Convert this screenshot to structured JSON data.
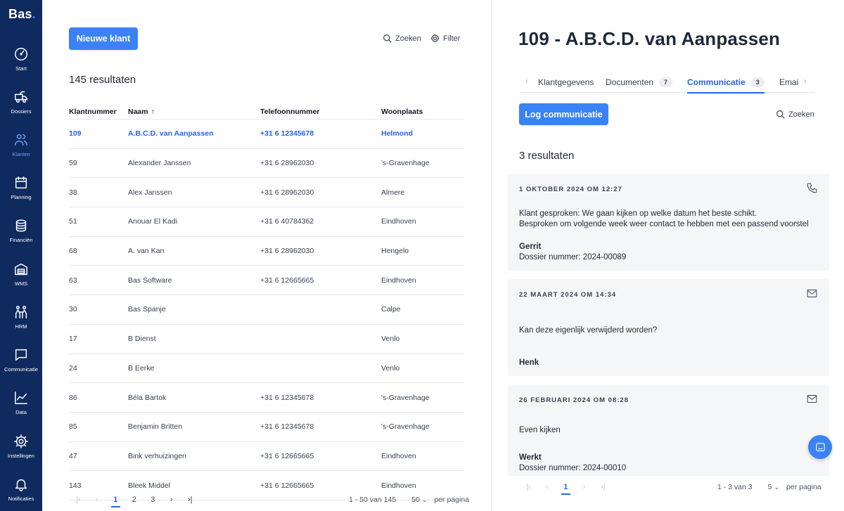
{
  "app": {
    "logo": "Bas",
    "logo_dot": "."
  },
  "sidebar": {
    "items": [
      {
        "label": "Start",
        "icon": "dashboard-icon",
        "active": false
      },
      {
        "label": "Dossiers",
        "icon": "truck-icon",
        "active": false
      },
      {
        "label": "Klanten",
        "icon": "users-icon",
        "active": true
      },
      {
        "label": "Planning",
        "icon": "calendar-icon",
        "active": false
      },
      {
        "label": "Financiën",
        "icon": "coins-icon",
        "active": false
      },
      {
        "label": "WMS",
        "icon": "warehouse-icon",
        "active": false
      },
      {
        "label": "HRM",
        "icon": "people-icon",
        "active": false
      },
      {
        "label": "Communicatie",
        "icon": "chat-icon",
        "active": false
      },
      {
        "label": "Data",
        "icon": "chart-icon",
        "active": false
      },
      {
        "label": "Instellingen",
        "icon": "gear-icon",
        "active": false
      },
      {
        "label": "Notificaties",
        "icon": "bell-icon",
        "active": false
      }
    ]
  },
  "list": {
    "new_button": "Nieuwe klant",
    "search_label": "Zoeken",
    "filter_label": "Filter",
    "results": "145 resultaten",
    "columns": [
      "Klantnummer",
      "Naam",
      "Telefoonnummer",
      "Woonplaats"
    ],
    "sort_arrow": "↑",
    "rows": [
      [
        "109",
        "A.B.C.D. van Aanpassen",
        "+31 6 12345678",
        "Helmond"
      ],
      [
        "59",
        "Alexander Janssen",
        "+31 6 28962030",
        "'s-Gravenhage"
      ],
      [
        "38",
        "Alex Janssen",
        "+31 6 28962030",
        "Almere"
      ],
      [
        "51",
        "Anouar El Kadi",
        "+31 6 40784362",
        "Eindhoven"
      ],
      [
        "68",
        "A. van Kan",
        "+31 6 28962030",
        "Hengelo"
      ],
      [
        "63",
        "Bas Software",
        "+31 6 12665665",
        "Eindhoven"
      ],
      [
        "30",
        "Bas Spanje",
        "",
        "Calpe"
      ],
      [
        "17",
        "B Dienst",
        "",
        "Venlo"
      ],
      [
        "24",
        "B Eerke",
        "",
        "Venlo"
      ],
      [
        "86",
        "Béla Bartok",
        "+31 6 12345678",
        "'s-Gravenhage"
      ],
      [
        "85",
        "Benjamin Britten",
        "+31 6 12345678",
        "'s-Gravenhage"
      ],
      [
        "47",
        "Bink verhuizingen",
        "+31 6 12665665",
        "Eindhoven"
      ],
      [
        "143",
        "Bleek Middel",
        "+31 6 12665665",
        "Eindhoven"
      ]
    ],
    "pager": {
      "first": "|‹",
      "prev": "‹",
      "pages": [
        "1",
        "2",
        "3"
      ],
      "next": "›",
      "last": "›|",
      "range": "1 - 50 van 145",
      "per_page": "50",
      "per_page_label": "per pagina",
      "chevron": "⌄"
    }
  },
  "detail": {
    "title": "109 - A.B.C.D. van Aanpassen",
    "tabs": [
      {
        "label": "Klantgegevens",
        "badge": ""
      },
      {
        "label": "Documenten",
        "badge": "7"
      },
      {
        "label": "Communicatie",
        "badge": "3"
      },
      {
        "label": "Emai",
        "badge": ""
      }
    ],
    "tab_prev": "‹",
    "tab_next": "›",
    "log_button": "Log communicatie",
    "search_label": "Zoeken",
    "results": "3 resultaten",
    "entries": [
      {
        "date": "1 OKTOBER 2024 OM 12:27",
        "icon": "phone-icon",
        "lines": [
          "Klant gesproken: We gaan kijken op welke datum het beste schikt.",
          "Besproken om volgende week weer contact te hebben met een passend voorstel"
        ],
        "author": "Gerrit",
        "sub": "Dossier nummer: 2024-00089"
      },
      {
        "date": "22 MAART 2024 OM 14:34",
        "icon": "mail-icon",
        "lines": [
          "Kan deze eigenlijk verwijderd worden?"
        ],
        "author": "Henk",
        "sub": ""
      },
      {
        "date": "26 FEBRUARI 2024 OM 08:28",
        "icon": "mail-icon",
        "lines": [
          "Even kijken"
        ],
        "author": "Werkt",
        "sub": "Dossier nummer: 2024-00010"
      }
    ],
    "pager": {
      "first": "|‹",
      "prev": "‹",
      "pages": [
        "1"
      ],
      "next": "›",
      "last": "›|",
      "range": "1 - 3 van 3",
      "per_page": "5",
      "per_page_label": "per pagina",
      "chevron": "⌄"
    }
  },
  "colors": {
    "sidebar": "#0f2a5e",
    "accent": "#3b82f6",
    "link": "#2563eb"
  }
}
